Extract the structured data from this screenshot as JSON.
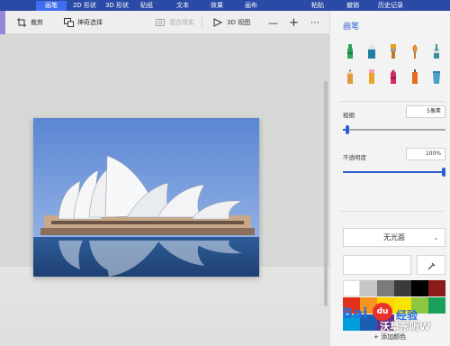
{
  "menu": {
    "tabs": [
      {
        "label": "画笔"
      },
      {
        "label": "2D 形状"
      },
      {
        "label": "3D 形状"
      },
      {
        "label": "贴纸"
      },
      {
        "label": "文本"
      },
      {
        "label": "效果"
      },
      {
        "label": "画布"
      }
    ],
    "active_index": 0,
    "paste_label": "粘贴",
    "undo_label": "撤销",
    "history_label": "历史记录"
  },
  "toolbar": {
    "crop_label": "裁剪",
    "magic_select_label": "神奇选择",
    "mixed_reality_label": "混合现实",
    "view3d_label": "3D 视图",
    "add_icon": "plus-icon",
    "more_icon": "ellipsis-icon"
  },
  "panel": {
    "title": "画笔",
    "brushes": [
      "marker-icon",
      "calligraphy-pen-icon",
      "oil-brush-icon",
      "watercolor-icon",
      "pixel-pen-icon",
      "pencil-icon",
      "eraser-icon",
      "crayon-icon",
      "spray-can-icon",
      "fill-bucket-icon"
    ],
    "thickness": {
      "label": "粗细",
      "value_text": "5像素",
      "fraction": 0.04
    },
    "opacity": {
      "label": "不透明度",
      "value_text": "100%",
      "fraction": 1.0
    },
    "finish": {
      "label": "无光面"
    },
    "add_color_label": "添加颜色",
    "accent": "#2b5fd1",
    "palette": [
      "#ffffff",
      "#c6c6c6",
      "#7b7b7b",
      "#3b3b3b",
      "#000000",
      "#8b1a1a",
      "#e0311b",
      "#f7941d",
      "#ffd200",
      "#f7e400",
      "#8dc63f",
      "#1aa05a",
      "#009ddb",
      "#1b5fb2",
      "#6a2c91"
    ]
  },
  "watermark": {
    "brand": "Bai",
    "paw": "du",
    "jingyan": "经验",
    "right_text": "沃草东听W"
  }
}
